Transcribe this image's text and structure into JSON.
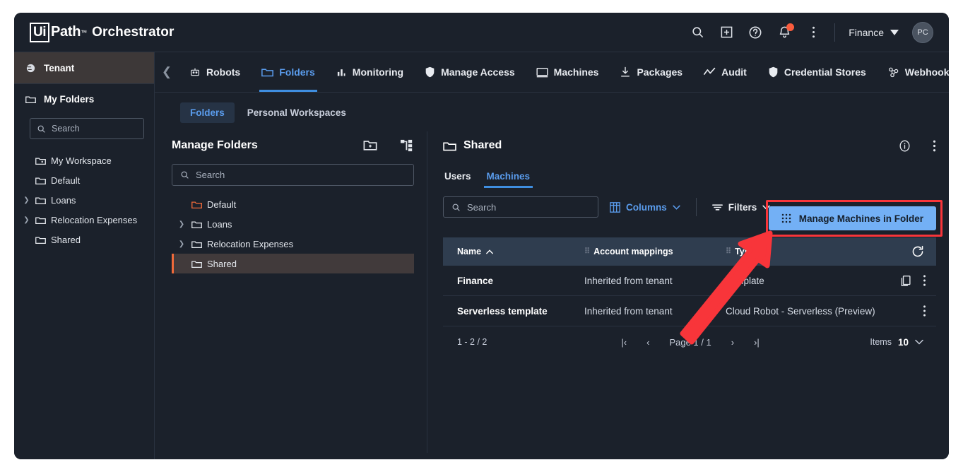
{
  "brand": {
    "ui": "Ui",
    "path": "Path",
    "tm": "™",
    "product": "Orchestrator"
  },
  "topbar": {
    "icons": [
      "search-icon",
      "add-box-icon",
      "help-icon",
      "notifications-icon",
      "more-vertical-icon"
    ],
    "tenant_selector": "Finance",
    "avatar_initials": "PC"
  },
  "nav": {
    "items": [
      {
        "label": "Robots",
        "icon": "robot-icon",
        "active": false
      },
      {
        "label": "Folders",
        "icon": "folder-icon",
        "active": true
      },
      {
        "label": "Monitoring",
        "icon": "chart-bars-icon",
        "active": false
      },
      {
        "label": "Manage Access",
        "icon": "shield-icon",
        "active": false
      },
      {
        "label": "Machines",
        "icon": "monitor-icon",
        "active": false
      },
      {
        "label": "Packages",
        "icon": "download-icon",
        "active": false
      },
      {
        "label": "Audit",
        "icon": "trend-line-icon",
        "active": false
      },
      {
        "label": "Credential Stores",
        "icon": "shield-icon",
        "active": false
      },
      {
        "label": "Webhooks",
        "icon": "webhook-icon",
        "active": false
      }
    ]
  },
  "sidebar": {
    "tenant_label": "Tenant",
    "my_folders_label": "My Folders",
    "search_placeholder": "Search",
    "tree": [
      {
        "label": "My Workspace",
        "icon": "workspace-folder-icon",
        "expandable": false
      },
      {
        "label": "Default",
        "icon": "folder-icon",
        "expandable": false
      },
      {
        "label": "Loans",
        "icon": "folder-icon",
        "expandable": true
      },
      {
        "label": "Relocation Expenses",
        "icon": "folder-icon",
        "expandable": true
      },
      {
        "label": "Shared",
        "icon": "folder-icon",
        "expandable": false
      }
    ]
  },
  "subtabs": [
    {
      "label": "Folders",
      "active": true
    },
    {
      "label": "Personal Workspaces",
      "active": false
    }
  ],
  "manage_folders": {
    "title": "Manage Folders",
    "search_placeholder": "Search",
    "icons": [
      "add-folder-icon",
      "org-tree-icon"
    ],
    "folders": [
      {
        "label": "Default",
        "expandable": false,
        "selected": false,
        "accent": "#f06a3a"
      },
      {
        "label": "Loans",
        "expandable": true,
        "selected": false,
        "accent": ""
      },
      {
        "label": "Relocation Expenses",
        "expandable": true,
        "selected": false,
        "accent": ""
      },
      {
        "label": "Shared",
        "expandable": false,
        "selected": true,
        "accent": ""
      }
    ]
  },
  "detail": {
    "title": "Shared",
    "head_icons": [
      "info-icon",
      "more-vertical-icon"
    ],
    "tabs": [
      {
        "label": "Users",
        "active": false
      },
      {
        "label": "Machines",
        "active": true
      }
    ],
    "search_placeholder": "Search",
    "columns_button": "Columns",
    "filters_button": "Filters",
    "manage_button": "Manage Machines in Folder",
    "table": {
      "headers": [
        "Name",
        "Account mappings",
        "Type"
      ],
      "sort_indicator": "^",
      "refresh_icon": "refresh-icon",
      "rows": [
        {
          "name": "Finance",
          "account_mappings": "Inherited from tenant",
          "type": "Template",
          "has_copy": true
        },
        {
          "name": "Serverless template",
          "account_mappings": "Inherited from tenant",
          "type": "Cloud Robot - Serverless (Preview)",
          "has_copy": false
        }
      ]
    },
    "pager": {
      "range": "1 - 2 / 2",
      "page_label": "Page 1 / 1",
      "items_label": "Items",
      "items_value": "10"
    }
  },
  "annotation": {
    "color": "#f8353a"
  },
  "colors": {
    "app_bg": "#1b212b",
    "accent_blue": "#5a9ced",
    "button_blue": "#73b0f5",
    "orange": "#f06a3a",
    "table_header": "#2f3d4f",
    "tenant_bg": "#3d3838",
    "selected_row": "#413a3b"
  }
}
